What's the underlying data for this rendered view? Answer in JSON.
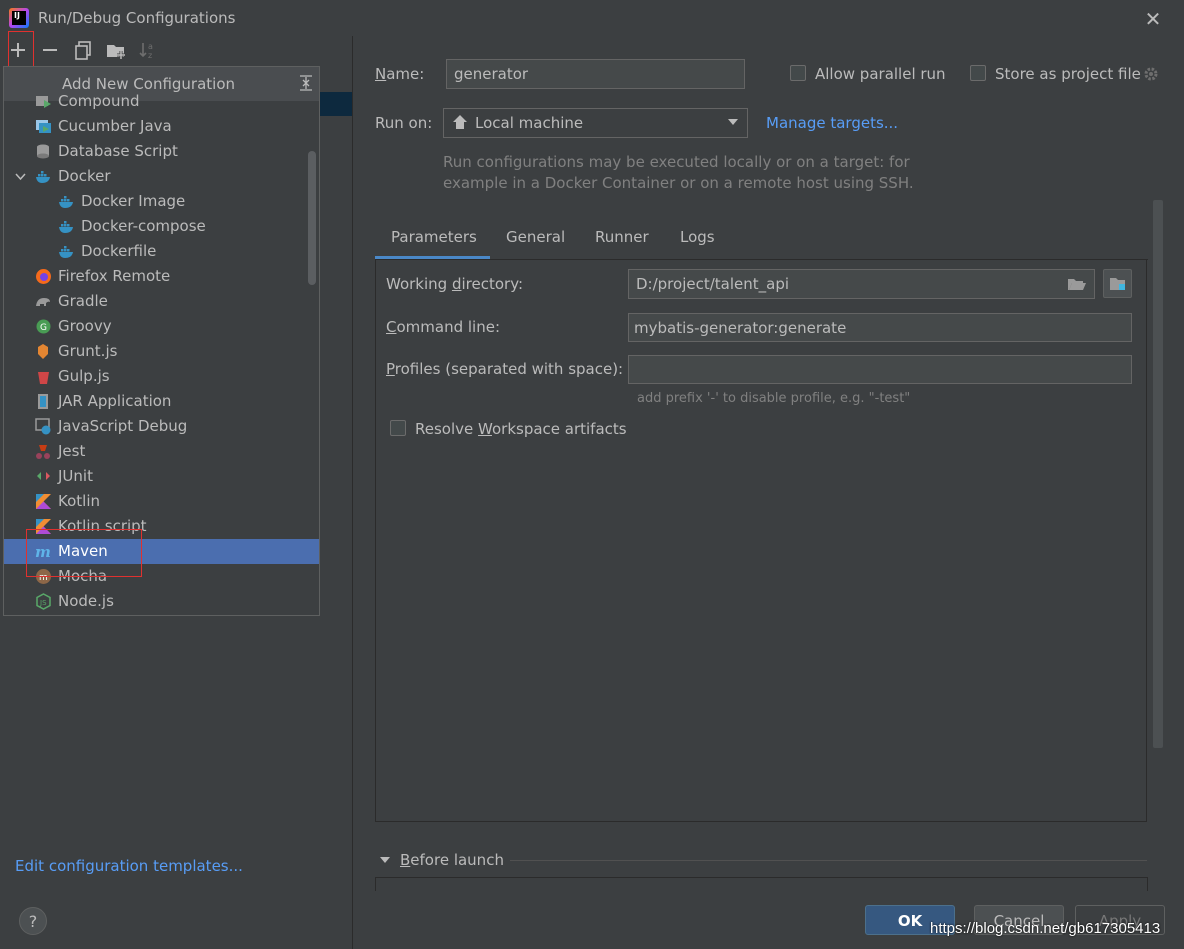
{
  "window": {
    "title": "Run/Debug Configurations",
    "close_glyph": "✕"
  },
  "toolbar": {
    "add": "+",
    "remove": "−"
  },
  "popup": {
    "title": "Add New Configuration",
    "items": [
      {
        "label": "Compound",
        "icon": "compound-icon"
      },
      {
        "label": "Cucumber Java",
        "icon": "cucumber-java-icon"
      },
      {
        "label": "Database Script",
        "icon": "database-script-icon"
      },
      {
        "label": "Docker",
        "icon": "docker-icon"
      },
      {
        "label": "Docker Image",
        "icon": "docker-icon"
      },
      {
        "label": "Docker-compose",
        "icon": "docker-icon"
      },
      {
        "label": "Dockerfile",
        "icon": "docker-icon"
      },
      {
        "label": "Firefox Remote",
        "icon": "firefox-icon"
      },
      {
        "label": "Gradle",
        "icon": "gradle-icon"
      },
      {
        "label": "Groovy",
        "icon": "groovy-icon"
      },
      {
        "label": "Grunt.js",
        "icon": "grunt-icon"
      },
      {
        "label": "Gulp.js",
        "icon": "gulp-icon"
      },
      {
        "label": "JAR Application",
        "icon": "jar-icon"
      },
      {
        "label": "JavaScript Debug",
        "icon": "javascript-debug-icon"
      },
      {
        "label": "Jest",
        "icon": "jest-icon"
      },
      {
        "label": "JUnit",
        "icon": "junit-icon"
      },
      {
        "label": "Kotlin",
        "icon": "kotlin-icon"
      },
      {
        "label": "Kotlin script",
        "icon": "kotlin-icon"
      },
      {
        "label": "Maven",
        "icon": "maven-icon"
      },
      {
        "label": "Mocha",
        "icon": "mocha-icon"
      },
      {
        "label": "Node.js",
        "icon": "nodejs-icon"
      }
    ],
    "selected": "Maven"
  },
  "left": {
    "edit_templates": "Edit configuration templates...",
    "help": "?"
  },
  "form": {
    "name_label": "Name:",
    "name_value": "generator",
    "allow_parallel": "Allow parallel run",
    "store_project": "Store as project file",
    "run_on_label": "Run on:",
    "run_on_value": "Local machine",
    "manage_targets": "Manage targets...",
    "run_hint_1": "Run configurations may be executed locally or on a target: for",
    "run_hint_2": "example in a Docker Container or on a remote host using SSH."
  },
  "tabs": [
    "Parameters",
    "General",
    "Runner",
    "Logs"
  ],
  "active_tab": "Parameters",
  "params": {
    "working_dir_label": "Working directory:",
    "working_dir_value": "D:/project/talent_api",
    "command_line_label": "Command line:",
    "command_line_value": "mybatis-generator:generate",
    "profiles_label": "Profiles (separated with space):",
    "profiles_value": "",
    "profiles_hint": "add prefix '-' to disable profile, e.g. \"-test\"",
    "resolve_workspace": "Resolve Workspace artifacts"
  },
  "before_launch": "Before launch",
  "buttons": {
    "ok": "OK",
    "cancel": "Cancel",
    "apply": "Apply"
  },
  "watermark": "https://blog.csdn.net/gb617305413",
  "colors": {
    "accent": "#4b6eaf",
    "link": "#589df6",
    "highlight": "#e0312f",
    "ok_button": "#365880"
  }
}
